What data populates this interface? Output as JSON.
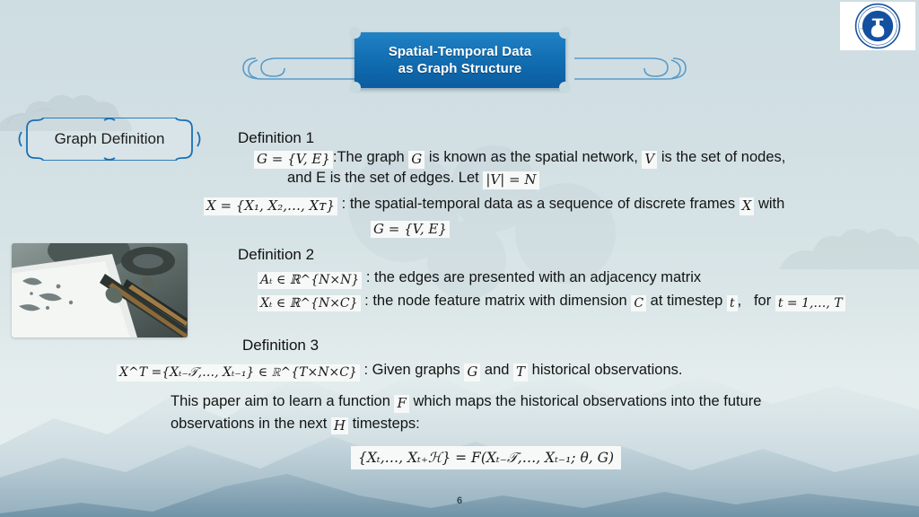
{
  "slide": {
    "title": "Spatial-Temporal Data\nas Graph Structure",
    "title_line1": "Spatial-Temporal Data",
    "title_line2": "as Graph Structure",
    "page_number": "6",
    "accent_color": "#1470b4",
    "banner_color_dark": "#0b5ca0",
    "background_color": "#d6e3e6",
    "logo_color": "#1450a0"
  },
  "section_label": {
    "text": "Graph Definition"
  },
  "definition1": {
    "heading": "Definition 1",
    "math_graph": "G = {V, E}",
    "text_a": ":The graph",
    "math_graph_inline": "G",
    "text_b": "is known as the spatial network,",
    "math_v": "V",
    "text_c": "is the set of nodes,",
    "text_d": "and E is the set of edges.  Let",
    "math_card": "|V| = N",
    "math_x_seq": "X = {X₁, X₂,…, Xᴛ}",
    "text_e": ":  the spatial-temporal data as a sequence of discrete frames",
    "math_x": "X",
    "text_f": "with",
    "math_graph2": "G = {V, E}"
  },
  "definition2": {
    "heading": "Definition 2",
    "math_a": "Aₜ ∈ ℝ^{N×N}",
    "text_a": ":  the edges are presented with an adjacency matrix",
    "math_x": "Xₜ ∈ ℝ^{N×C}",
    "text_b": ":  the node feature matrix with dimension",
    "math_c": "C",
    "text_c": "at timestep",
    "math_t": "t",
    "text_d": ",",
    "text_e": "for",
    "math_range": "t = 1,…, T"
  },
  "definition3": {
    "heading": "Definition 3",
    "math_xt": "X^T ={Xₜ₋𝒯,…, Xₜ₋₁} ∈ ℝ^{T×N×C}",
    "text_a": ":  Given graphs",
    "math_g": "G",
    "text_b": "and",
    "math_tau": "T",
    "text_c": "historical observations."
  },
  "paragraph": {
    "text_a": "This paper aim to learn a function",
    "math_f": "F",
    "text_b": "which maps the historical observations into the future",
    "text_c": "observations in the next",
    "math_h": "H",
    "text_d": "timesteps:"
  },
  "final_formula": {
    "text": "{Xₜ,…, Xₜ₊ℋ} = F(Xₜ₋𝒯,…, Xₜ₋₁; θ, G)"
  },
  "icons": {
    "logo": "university-seal-icon",
    "swirl_left": "scroll-swirl-left-icon",
    "swirl_right": "scroll-swirl-right-icon",
    "photo": "calligraphy-brush-photo"
  }
}
